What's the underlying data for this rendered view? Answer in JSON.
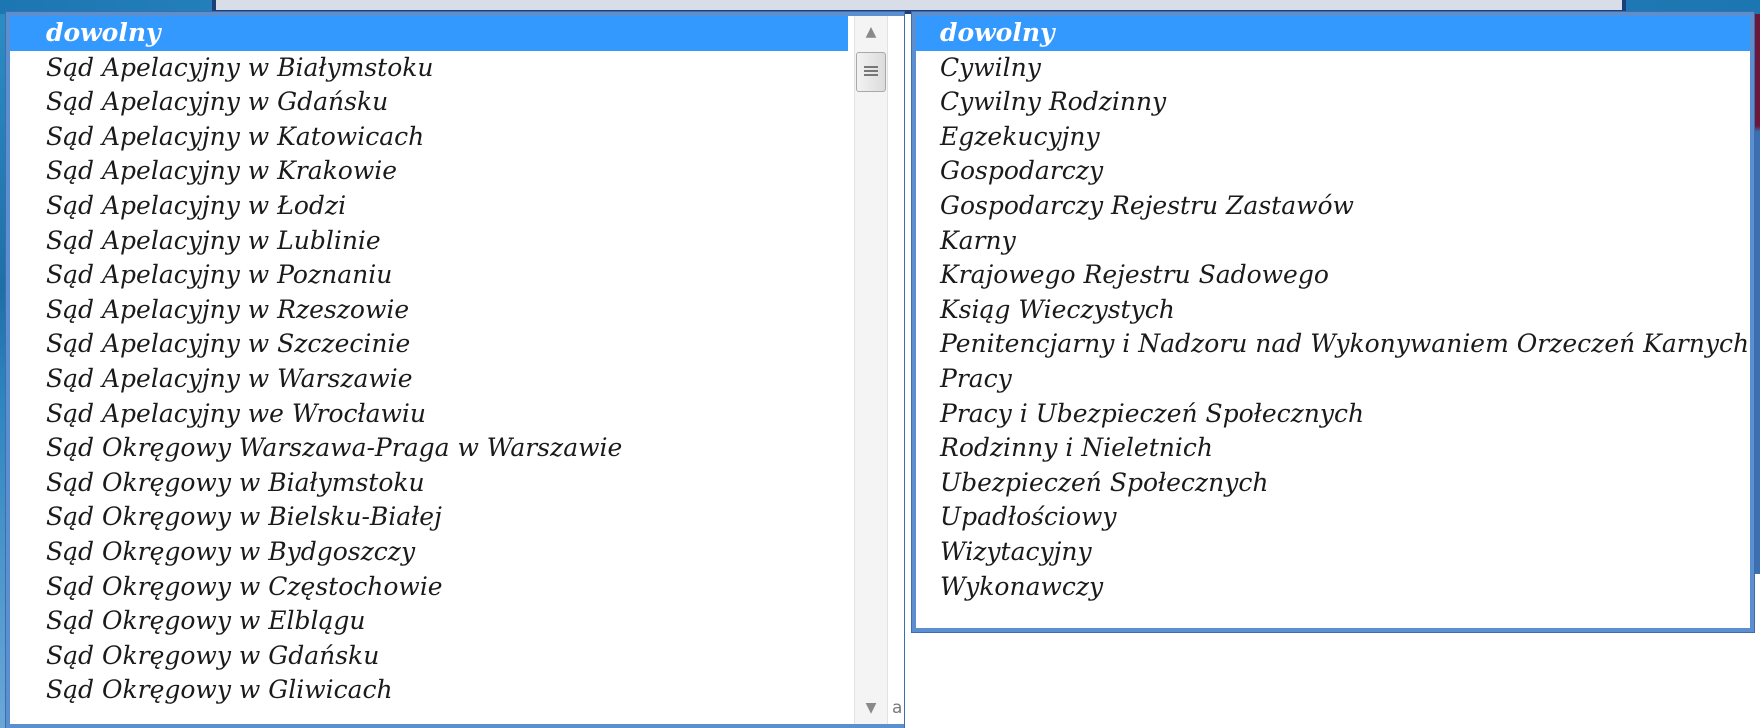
{
  "left_dropdown": {
    "options": [
      "dowolny",
      "Sąd Apelacyjny w Białymstoku",
      "Sąd Apelacyjny w Gdańsku",
      "Sąd Apelacyjny w Katowicach",
      "Sąd Apelacyjny w Krakowie",
      "Sąd Apelacyjny w Łodzi",
      "Sąd Apelacyjny w Lublinie",
      "Sąd Apelacyjny w Poznaniu",
      "Sąd Apelacyjny w Rzeszowie",
      "Sąd Apelacyjny w Szczecinie",
      "Sąd Apelacyjny w Warszawie",
      "Sąd Apelacyjny we Wrocławiu",
      "Sąd Okręgowy Warszawa-Praga w Warszawie",
      "Sąd Okręgowy w Białymstoku",
      "Sąd Okręgowy w Bielsku-Białej",
      "Sąd Okręgowy w Bydgoszczy",
      "Sąd Okręgowy w Częstochowie",
      "Sąd Okręgowy w Elblągu",
      "Sąd Okręgowy w Gdańsku",
      "Sąd Okręgowy w Gliwicach"
    ],
    "selected": "dowolny",
    "scrollbar": {
      "up_icon": "chevron-up-icon",
      "down_icon": "chevron-down-icon",
      "thumb_icon": "grip-icon",
      "side_fragment": "a"
    }
  },
  "right_dropdown": {
    "options": [
      "dowolny",
      "Cywilny",
      "Cywilny Rodzinny",
      "Egzekucyjny",
      "Gospodarczy",
      "Gospodarczy Rejestru Zastawów",
      "Karny",
      "Krajowego Rejestru Sadowego",
      "Ksiąg Wieczystych",
      "Penitencjarny i Nadzoru nad Wykonywaniem Orzeczeń Karnych",
      "Pracy",
      "Pracy i Ubezpieczeń Społecznych",
      "Rodzinny i Nieletnich",
      "Ubezpieczeń Społecznych",
      "Upadłościowy",
      "Wizytacyjny",
      "Wykonawczy"
    ],
    "selected": "dowolny"
  },
  "colors": {
    "selection": "#3399ff",
    "border": "#5b8fd0",
    "page_blue": "#1f6fa7",
    "page_maroon": "#6c1738"
  }
}
